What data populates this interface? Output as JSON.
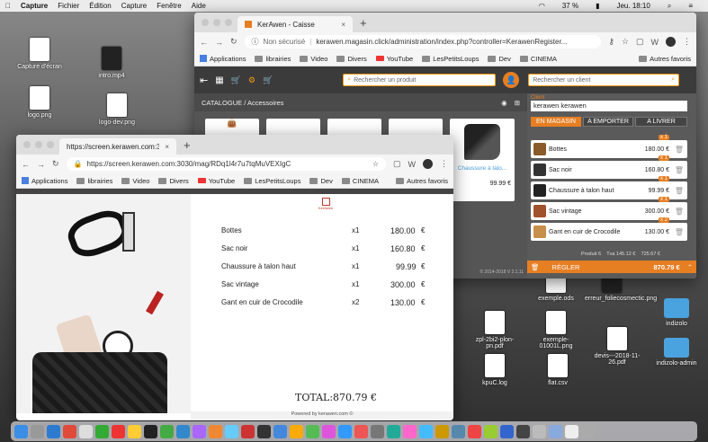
{
  "menubar": {
    "app": "Capture",
    "items": [
      "Fichier",
      "Édition",
      "Capture",
      "Fenêtre",
      "Aide"
    ],
    "battery": "37 %",
    "clock": "Jeu. 18:10"
  },
  "desktop": {
    "icons": [
      {
        "label": "Capture d'écran"
      },
      {
        "label": "intro.mp4"
      },
      {
        "label": "logo.png"
      },
      {
        "label": "logo-dev.png"
      },
      {
        "label": "exemple.ods"
      },
      {
        "label": "erreur_foliecosmectic.png"
      },
      {
        "label": "indizolo"
      },
      {
        "label": "zpl-2bi2-plon-pn.pdf"
      },
      {
        "label": "exemple-01001L.png"
      },
      {
        "label": "devis---2018-11-26.pdf"
      },
      {
        "label": "indizolo-admin"
      },
      {
        "label": "kpuC.log"
      },
      {
        "label": "flat.csv"
      }
    ]
  },
  "back_window": {
    "tab_title": "KerAwen - Caisse",
    "url_insecure": "Non sécurisé",
    "url": "kerawen.magasin.click/administration/index.php?controller=KerawenRegister...",
    "bookmarks": [
      "Applications",
      "librairies",
      "Video",
      "Divers",
      "YouTube",
      "LesPetitsLoups",
      "Dev",
      "CINEMA"
    ],
    "bookmarks_more": "Autres favoris",
    "search_product_placeholder": "Rechercher un produit",
    "search_client_placeholder": "Rechercher un client",
    "breadcrumb": "CATALOGUE / Accessoires",
    "featured_product": {
      "name": "Chaussure à talo...",
      "price": "99.99 €"
    },
    "customer_label": "Client",
    "customer": "kerawen kerawen",
    "modes": [
      "EN MAGASIN",
      "A EMPORTER",
      "A LIVRER"
    ],
    "cart": [
      {
        "name": "Bottes",
        "qty": "x 1",
        "price": "180.00 €"
      },
      {
        "name": "Sac noir",
        "qty": "x 1",
        "price": "160.80 €"
      },
      {
        "name": "Chaussure à talon haut",
        "qty": "x 1",
        "price": "99.99 €"
      },
      {
        "name": "Sac vintage",
        "qty": "x 1",
        "price": "300.00 €"
      },
      {
        "name": "Gant en cuir de Crocodile",
        "qty": "x 2",
        "price": "130.00 €"
      }
    ],
    "summary": {
      "products": "Produit 6",
      "tva": "Tva 145.12 €",
      "ht": "725.67 €"
    },
    "pay_button": "RÉGLER",
    "total": "870.79 €",
    "footer": "© 2014-2018 V 2.1.11"
  },
  "front_window": {
    "tab_title": "https://screen.kerawen.com:30...",
    "url": "https://screen.kerawen.com:3030/mag/RDq1l4r7u7tqMuVEXIgC",
    "bookmarks": [
      "Applications",
      "librairies",
      "Video",
      "Divers",
      "YouTube",
      "LesPetitsLoups",
      "Dev",
      "CINEMA"
    ],
    "bookmarks_more": "Autres favoris",
    "logo_text": "KerAwen",
    "items": [
      {
        "name": "Bottes",
        "qty": "x1",
        "price": "180.00",
        "cur": "€"
      },
      {
        "name": "Sac noir",
        "qty": "x1",
        "price": "160.80",
        "cur": "€"
      },
      {
        "name": "Chaussure à talon haut",
        "qty": "x1",
        "price": "99.99",
        "cur": "€"
      },
      {
        "name": "Sac vintage",
        "qty": "x1",
        "price": "300.00",
        "cur": "€"
      },
      {
        "name": "Gant en cuir de Crocodile",
        "qty": "x2",
        "price": "130.00",
        "cur": "€"
      }
    ],
    "total": "TOTAL:870.79 €",
    "footer": "Powered by kerawen.com ©"
  }
}
